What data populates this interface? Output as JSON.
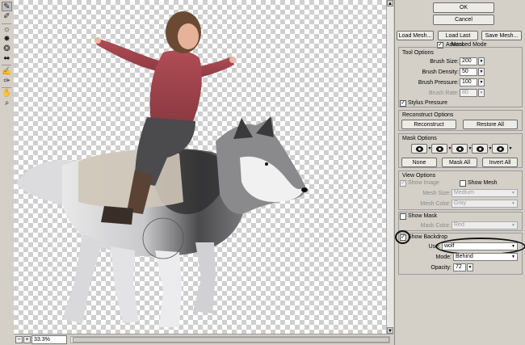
{
  "toolbar": {
    "tools": [
      {
        "name": "warp",
        "icon": "warp-icon",
        "active": true
      },
      {
        "name": "reconstruct",
        "icon": "reconstruct-brush-icon"
      },
      {
        "name": "twirl",
        "icon": "twirl-icon"
      },
      {
        "name": "pucker",
        "icon": "pucker-icon"
      },
      {
        "name": "bloat",
        "icon": "bloat-icon"
      },
      {
        "name": "push-left",
        "icon": "push-left-icon"
      },
      {
        "name": "freeze-mask",
        "icon": "freeze-mask-icon"
      },
      {
        "name": "thaw-mask",
        "icon": "thaw-mask-icon"
      },
      {
        "name": "hand",
        "icon": "hand-icon"
      },
      {
        "name": "zoom",
        "icon": "zoom-icon"
      }
    ]
  },
  "status": {
    "zoom_value": "33.3%"
  },
  "panel": {
    "ok_label": "OK",
    "cancel_label": "Cancel",
    "load_mesh_label": "Load Mesh...",
    "load_last_mesh_label": "Load Last Mesh",
    "save_mesh_label": "Save Mesh...",
    "advanced_mode_label": "Advanced Mode",
    "advanced_mode_checked": true,
    "tool_options": {
      "title": "Tool Options",
      "brush_size_label": "Brush Size:",
      "brush_size_value": "200",
      "brush_density_label": "Brush Density:",
      "brush_density_value": "50",
      "brush_pressure_label": "Brush Pressure:",
      "brush_pressure_value": "100",
      "brush_rate_label": "Brush Rate:",
      "brush_rate_value": "80",
      "stylus_pressure_label": "Stylus Pressure",
      "stylus_pressure_checked": true
    },
    "reconstruct_options": {
      "title": "Reconstruct Options",
      "reconstruct_label": "Reconstruct",
      "restore_all_label": "Restore All"
    },
    "mask_options": {
      "title": "Mask Options",
      "none_label": "None",
      "mask_all_label": "Mask All",
      "invert_all_label": "Invert All"
    },
    "view_options": {
      "title": "View Options",
      "show_image_label": "Show Image",
      "show_image_checked": true,
      "show_mesh_label": "Show Mesh",
      "show_mesh_checked": false,
      "mesh_size_label": "Mesh Size:",
      "mesh_size_value": "Medium",
      "mesh_color_label": "Mesh Color:",
      "mesh_color_value": "Gray"
    },
    "show_mask": {
      "label": "Show Mask",
      "checked": false,
      "mask_color_label": "Mask Color:",
      "mask_color_value": "Red"
    },
    "show_backdrop": {
      "label": "Show Backdrop",
      "checked": true,
      "use_label": "Use:",
      "use_value": "wolf",
      "mode_label": "Mode:",
      "mode_value": "Behind",
      "opacity_label": "Opacity:",
      "opacity_value": "72"
    }
  },
  "colors": {
    "panel_bg": "#d4d0c8",
    "checker": "#cfcfcf",
    "highlight_ring": "#111111"
  }
}
